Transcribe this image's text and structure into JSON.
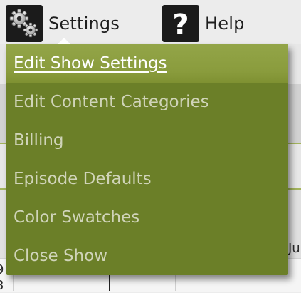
{
  "toolbar": {
    "settings": {
      "label": "Settings",
      "icon": "gears-icon"
    },
    "help": {
      "label": "Help",
      "icon": "question-mark-icon"
    }
  },
  "background": {
    "fragment_right": "Ju",
    "fragment_left_top": "9",
    "fragment_left_bottom": "3"
  },
  "menu": {
    "items": [
      {
        "label": "Edit Show Settings",
        "active": true
      },
      {
        "label": "Edit Content Categories",
        "active": false
      },
      {
        "label": "Billing",
        "active": false
      },
      {
        "label": "Episode Defaults",
        "active": false
      },
      {
        "label": "Color Swatches",
        "active": false
      },
      {
        "label": "Close Show",
        "active": false
      }
    ]
  },
  "colors": {
    "menu_bg": "#6b7f28",
    "menu_active": "#8a9c3d",
    "menu_text": "#d0d4b9",
    "menu_active_text": "#ffffff",
    "toolbar_text": "#1e1e1e"
  }
}
